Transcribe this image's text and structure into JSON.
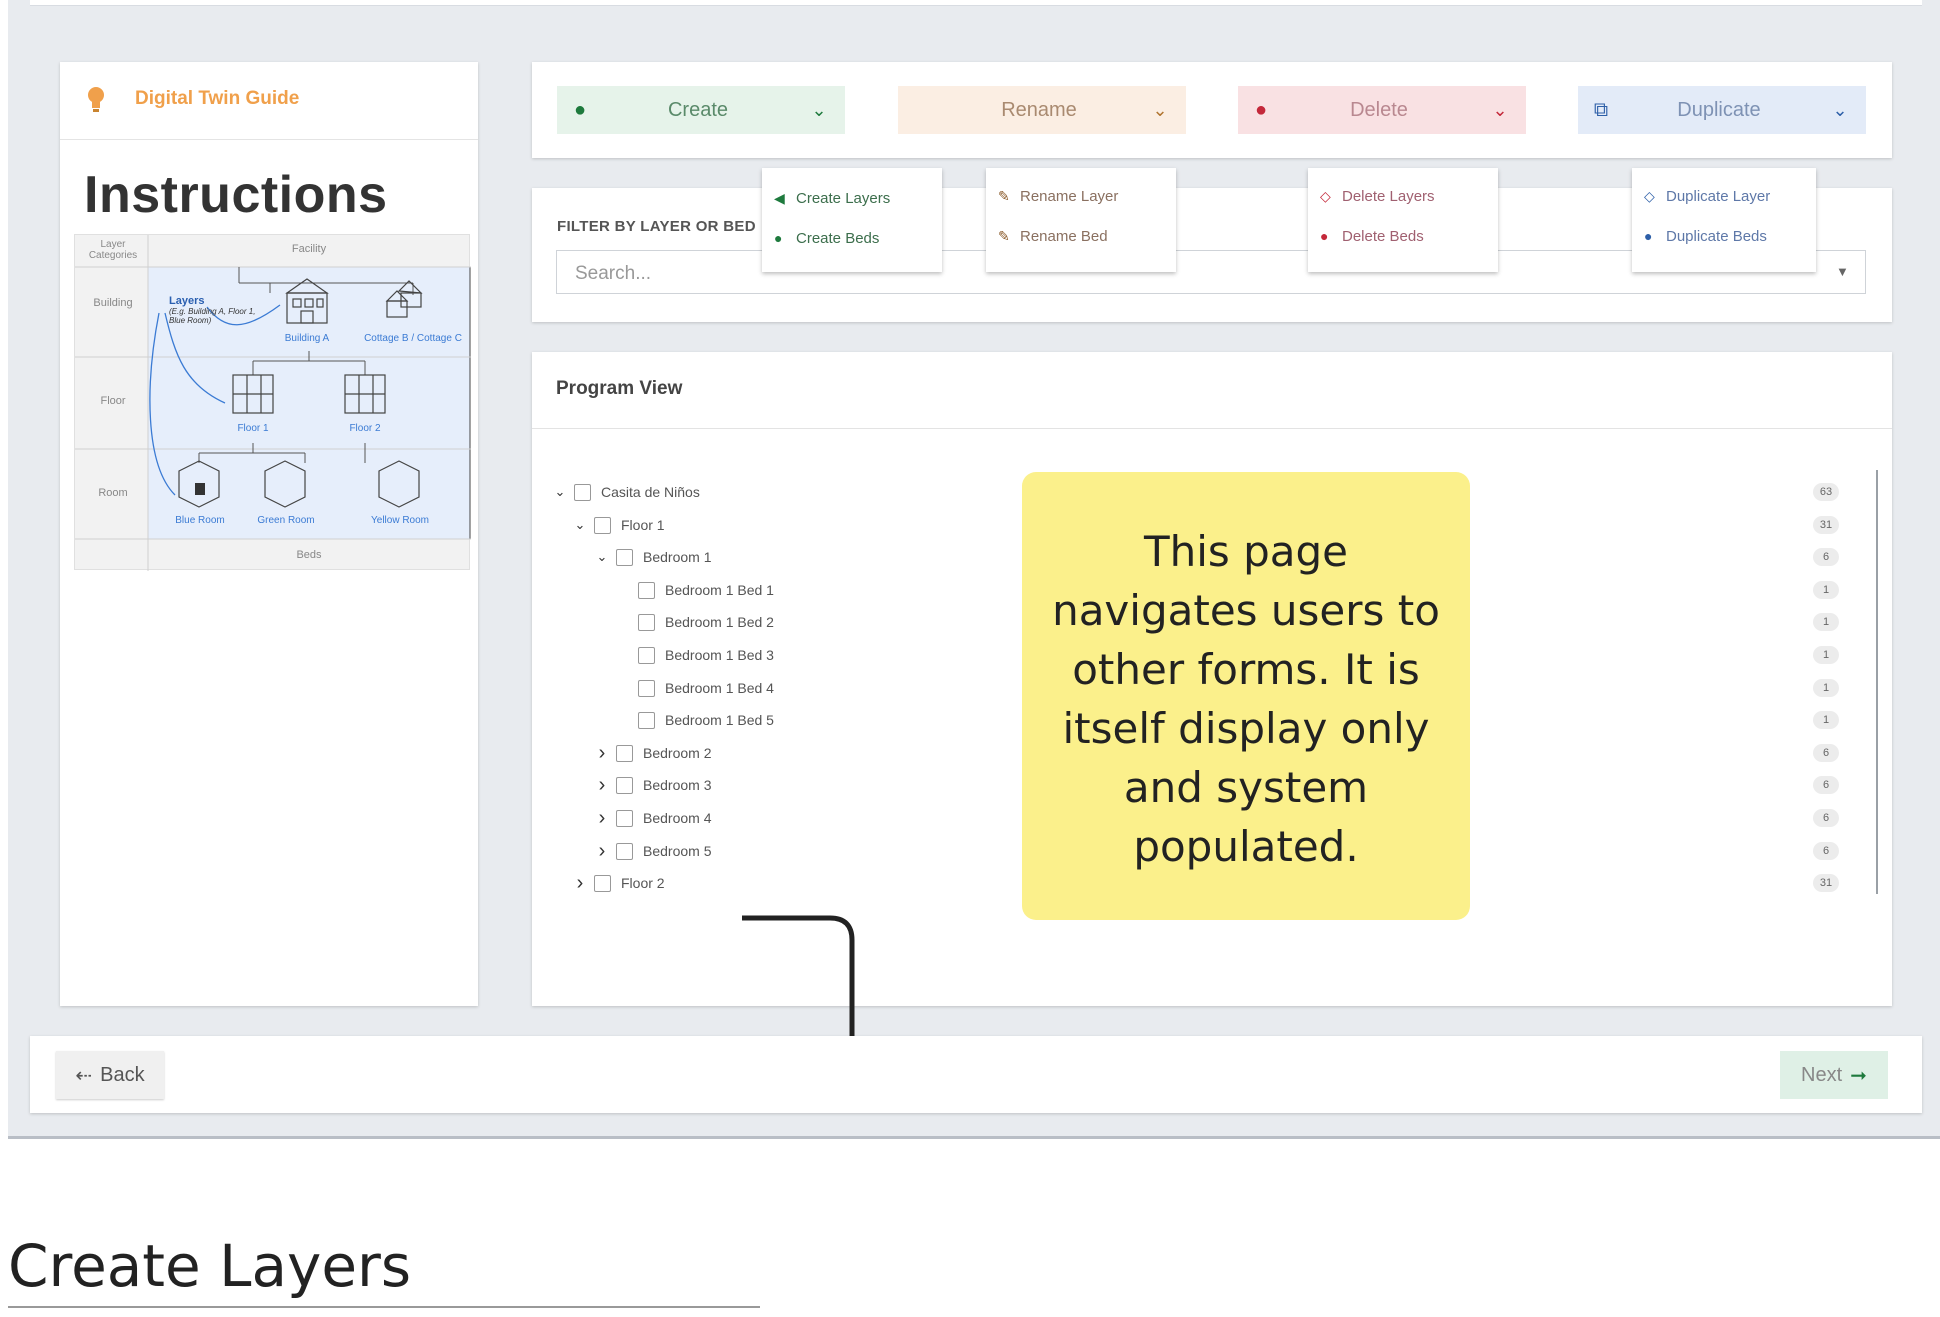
{
  "guide": {
    "title": "Digital Twin Guide",
    "heading": "Instructions",
    "diagram": {
      "header_left": "Layer Categories",
      "header_right": "Facility",
      "rows": [
        "Building",
        "Floor",
        "Room"
      ],
      "footer": "Beds",
      "layers_title": "Layers",
      "layers_example": "(E.g. Building A, Floor 1, Blue Room)",
      "buildings": [
        "Building A",
        "Cottage B / Cottage C"
      ],
      "floors": [
        "Floor 1",
        "Floor 2"
      ],
      "rooms": [
        "Blue Room",
        "Green Room",
        "Yellow Room"
      ]
    }
  },
  "actions": {
    "create": {
      "label": "Create",
      "color": "#e6f3ea",
      "icon": "create-icon"
    },
    "rename": {
      "label": "Rename",
      "color": "#fbeee3",
      "icon": ""
    },
    "delete": {
      "label": "Delete",
      "color": "#f9e1e3",
      "icon": "delete-icon"
    },
    "duplicate": {
      "label": "Duplicate",
      "color": "#e3ebf8",
      "icon": "duplicate-icon"
    }
  },
  "dropdowns": {
    "create": [
      "Create Layers",
      "Create Beds"
    ],
    "rename": [
      "Rename Layer",
      "Rename Bed"
    ],
    "delete": [
      "Delete Layers",
      "Delete Beds"
    ],
    "duplicate": [
      "Duplicate Layer",
      "Duplicate Beds"
    ]
  },
  "filter": {
    "label": "FILTER BY LAYER OR BED",
    "placeholder": "Search..."
  },
  "program_view": {
    "title": "Program View",
    "tree": [
      {
        "label": "Casita de Niños",
        "count": "63",
        "toggle": "expanded"
      },
      {
        "label": "Floor 1",
        "count": "31",
        "toggle": "expanded"
      },
      {
        "label": "Bedroom 1",
        "count": "6",
        "toggle": "expanded"
      },
      {
        "label": "Bedroom 1 Bed 1",
        "count": "1",
        "toggle": "none"
      },
      {
        "label": "Bedroom 1 Bed 2",
        "count": "1",
        "toggle": "none"
      },
      {
        "label": "Bedroom 1 Bed 3",
        "count": "1",
        "toggle": "none"
      },
      {
        "label": "Bedroom 1 Bed 4",
        "count": "1",
        "toggle": "none"
      },
      {
        "label": "Bedroom 1 Bed 5",
        "count": "1",
        "toggle": "none"
      },
      {
        "label": "Bedroom 2",
        "count": "6",
        "toggle": "collapsed"
      },
      {
        "label": "Bedroom 3",
        "count": "6",
        "toggle": "collapsed"
      },
      {
        "label": "Bedroom 4",
        "count": "6",
        "toggle": "collapsed"
      },
      {
        "label": "Bedroom 5",
        "count": "6",
        "toggle": "collapsed"
      },
      {
        "label": "Floor 2",
        "count": "31",
        "toggle": "collapsed"
      }
    ]
  },
  "annotation": {
    "note": "This page navigates users to other forms. It is itself display only and system populated."
  },
  "footer": {
    "back_label": "Back",
    "next_label": "Next"
  },
  "section": {
    "title": "Create Layers"
  }
}
